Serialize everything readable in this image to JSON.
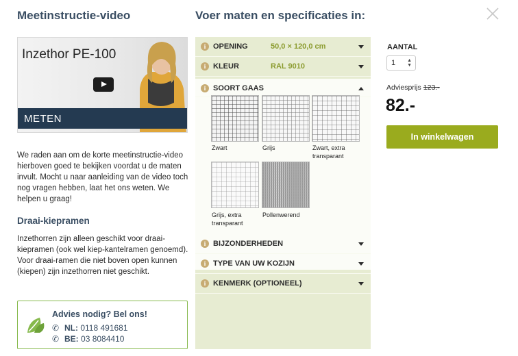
{
  "left": {
    "title": "Meetinstructie-video",
    "video": {
      "title": "Inzethor PE-100",
      "band_label": "METEN"
    },
    "intro": "We raden aan om de korte meetinstructie-video hierboven goed te bekijken voordat u de maten invult. Mocht u naar aanleiding van de video toch nog vragen hebben, laat het ons weten. We helpen u graag!",
    "subtitle": "Draai-kiepramen",
    "subtext": "Inzethorren zijn alleen geschikt voor draai-kiepramen (ook wel kiep-kantelramen genoemd). Voor draai-ramen die niet boven open kunnen (kiepen) zijn inzethorren niet geschikt.",
    "advice": {
      "question": "Advies nodig? Bel ons!",
      "nl_label": "NL:",
      "nl_phone": "0118 491681",
      "be_label": "BE:",
      "be_phone": "03 8084410"
    }
  },
  "spec": {
    "title": "Voer maten en specificaties in:",
    "rows": [
      {
        "label": "OPENING",
        "value": "50,0  ×  120,0 cm"
      },
      {
        "label": "KLEUR",
        "value": "RAL 9010"
      }
    ],
    "gaas": {
      "label": "SOORT GAAS",
      "options": [
        {
          "label": "Zwart"
        },
        {
          "label": "Grijs"
        },
        {
          "label": "Zwart, extra transparant"
        },
        {
          "label": "Grijs, extra transparant"
        },
        {
          "label": "Pollenwerend"
        }
      ]
    },
    "lower_rows": [
      {
        "label": "BIJZONDERHEDEN"
      },
      {
        "label": "TYPE VAN UW KOZIJN"
      },
      {
        "label": "KENMERK (OPTIONEEL)"
      }
    ],
    "info_glyph": "i"
  },
  "order": {
    "quantity_label": "AANTAL",
    "quantity_value": "1",
    "advies_label": "Adviesprijs",
    "advies_old": "123.-",
    "price": "82.-",
    "cart_button": "In winkelwagen"
  },
  "colors": {
    "accent_green": "#9aab1e",
    "panel_bg": "#e7ecd2",
    "heading": "#3a4e63",
    "info_icon": "#c7ab72"
  }
}
